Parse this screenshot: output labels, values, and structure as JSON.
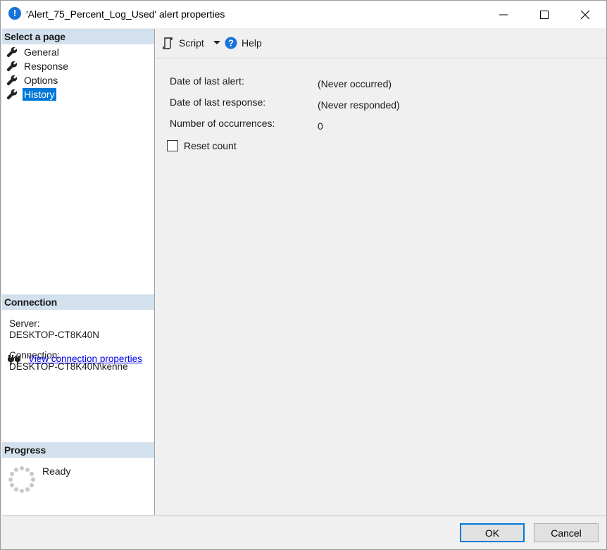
{
  "window": {
    "title": "'Alert_75_Percent_Log_Used' alert properties",
    "icon": "exclamation-icon"
  },
  "left_pane": {
    "select_page_header": "Select a page",
    "pages": [
      {
        "label": "General",
        "selected": false
      },
      {
        "label": "Response",
        "selected": false
      },
      {
        "label": "Options",
        "selected": false
      },
      {
        "label": "History",
        "selected": true
      }
    ],
    "connection_header": "Connection",
    "server_label": "Server:",
    "server_value": "DESKTOP-CT8K40N",
    "connection_label": "Connection:",
    "connection_value": "DESKTOP-CT8K40N\\kenne",
    "view_connection_link": "View connection properties",
    "progress_header": "Progress",
    "progress_status": "Ready"
  },
  "toolbar": {
    "script_label": "Script",
    "help_label": "Help"
  },
  "history": {
    "last_alert_label": "Date of last alert:",
    "last_alert_value": "(Never occurred)",
    "last_response_label": "Date of last response:",
    "last_response_value": "(Never responded)",
    "occurrences_label": "Number of occurrences:",
    "occurrences_value": "0",
    "reset_count_label": "Reset count",
    "reset_count_checked": false
  },
  "footer": {
    "ok_label": "OK",
    "cancel_label": "Cancel"
  },
  "colors": {
    "accent": "#0078d7",
    "section_header": "#d3e0ed",
    "link": "#0000ee"
  }
}
